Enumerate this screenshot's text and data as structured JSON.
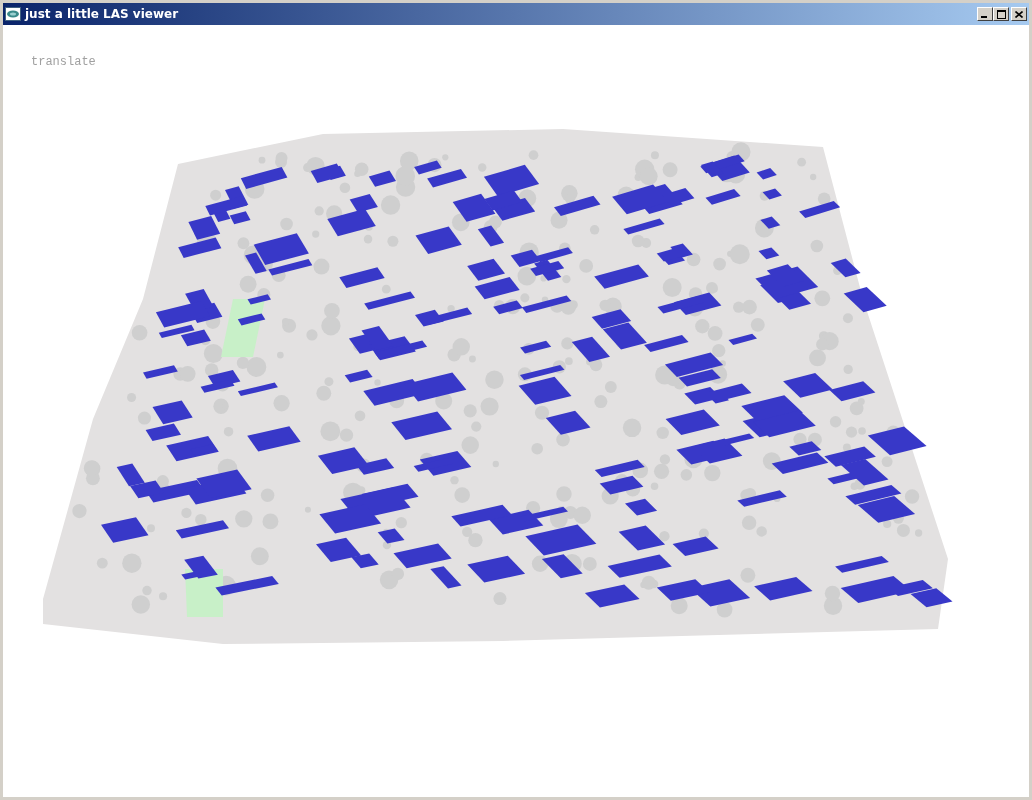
{
  "window": {
    "title": "just a little LAS viewer"
  },
  "viewport": {
    "mode_label": "translate"
  }
}
